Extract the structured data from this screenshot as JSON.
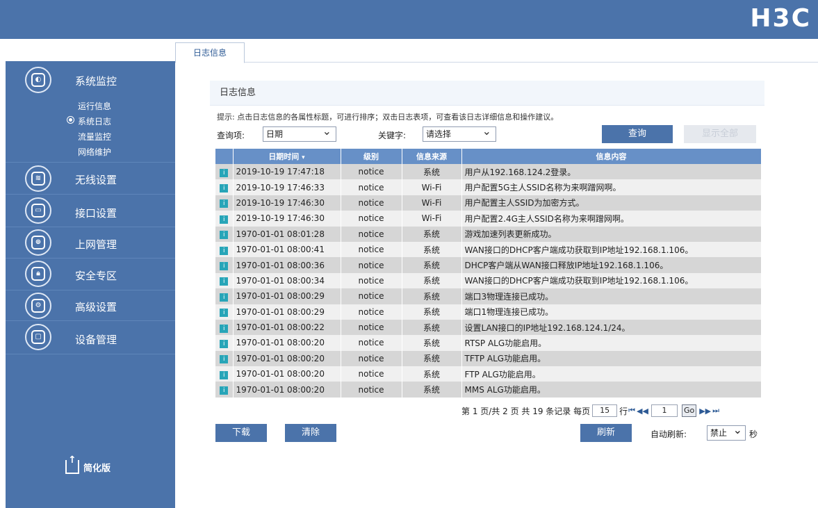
{
  "header": {
    "logo": "H3C"
  },
  "tabs": [
    {
      "label": "日志信息"
    }
  ],
  "sidebar": {
    "sections": [
      {
        "label": "系统监控",
        "icon": "monitor-icon",
        "sub": [
          "运行信息",
          "系统日志",
          "流量监控",
          "网络维护"
        ],
        "active_sub": 1
      },
      {
        "label": "无线设置",
        "icon": "wireless-icon"
      },
      {
        "label": "接口设置",
        "icon": "interface-icon"
      },
      {
        "label": "上网管理",
        "icon": "internet-icon"
      },
      {
        "label": "安全专区",
        "icon": "security-icon"
      },
      {
        "label": "高级设置",
        "icon": "gear-icon"
      },
      {
        "label": "设备管理",
        "icon": "device-icon"
      }
    ],
    "simple_link": "简化版"
  },
  "panel": {
    "title": "日志信息",
    "hint": "提示: 点击日志信息的各属性标题，可进行排序；双击日志表项，可查看该日志详细信息和操作建议。",
    "query_label": "查询项:",
    "query_value": "日期",
    "keyword_label": "关键字:",
    "keyword_value": "请选择",
    "search_button": "查询",
    "show_all_button": "显示全部"
  },
  "table": {
    "headers": [
      "日期时间",
      "级别",
      "信息来源",
      "信息内容"
    ],
    "rows": [
      {
        "datetime": "2019-10-19 17:47:18",
        "level": "notice",
        "source": "系统",
        "content": "用户从192.168.124.2登录。"
      },
      {
        "datetime": "2019-10-19 17:46:33",
        "level": "notice",
        "source": "Wi-Fi",
        "content": "用户配置5G主人SSID名称为来啊蹭网啊。"
      },
      {
        "datetime": "2019-10-19 17:46:30",
        "level": "notice",
        "source": "Wi-Fi",
        "content": "用户配置主人SSID为加密方式。"
      },
      {
        "datetime": "2019-10-19 17:46:30",
        "level": "notice",
        "source": "Wi-Fi",
        "content": "用户配置2.4G主人SSID名称为来啊蹭网啊。"
      },
      {
        "datetime": "1970-01-01 08:01:28",
        "level": "notice",
        "source": "系统",
        "content": "游戏加速列表更新成功。"
      },
      {
        "datetime": "1970-01-01 08:00:41",
        "level": "notice",
        "source": "系统",
        "content": "WAN接口的DHCP客户端成功获取到IP地址192.168.1.106。"
      },
      {
        "datetime": "1970-01-01 08:00:36",
        "level": "notice",
        "source": "系统",
        "content": "DHCP客户端从WAN接口释放IP地址192.168.1.106。"
      },
      {
        "datetime": "1970-01-01 08:00:34",
        "level": "notice",
        "source": "系统",
        "content": "WAN接口的DHCP客户端成功获取到IP地址192.168.1.106。"
      },
      {
        "datetime": "1970-01-01 08:00:29",
        "level": "notice",
        "source": "系统",
        "content": "端口3物理连接已成功。"
      },
      {
        "datetime": "1970-01-01 08:00:29",
        "level": "notice",
        "source": "系统",
        "content": "端口1物理连接已成功。"
      },
      {
        "datetime": "1970-01-01 08:00:22",
        "level": "notice",
        "source": "系统",
        "content": "设置LAN接口的IP地址192.168.124.1/24。"
      },
      {
        "datetime": "1970-01-01 08:00:20",
        "level": "notice",
        "source": "系统",
        "content": "RTSP ALG功能启用。"
      },
      {
        "datetime": "1970-01-01 08:00:20",
        "level": "notice",
        "source": "系统",
        "content": "TFTP ALG功能启用。"
      },
      {
        "datetime": "1970-01-01 08:00:20",
        "level": "notice",
        "source": "系统",
        "content": "FTP ALG功能启用。"
      },
      {
        "datetime": "1970-01-01 08:00:20",
        "level": "notice",
        "source": "系统",
        "content": "MMS ALG功能启用。"
      }
    ]
  },
  "pager": {
    "summary": "第 1 页/共 2 页  共 19 条记录  每页",
    "per_page": "15",
    "row_unit": "行",
    "page_input": "1",
    "go": "Go"
  },
  "actions": {
    "download": "下载",
    "clear": "清除",
    "refresh": "刷新",
    "auto_refresh_label": "自动刷新:",
    "auto_refresh_value": "禁止",
    "auto_refresh_unit": "秒"
  }
}
